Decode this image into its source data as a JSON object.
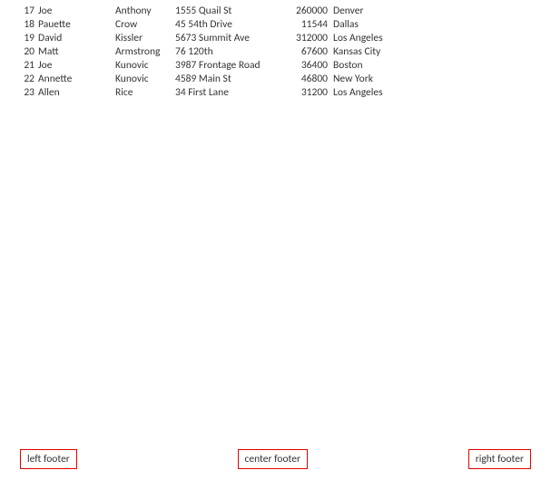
{
  "rows": [
    {
      "id": "17",
      "first": "Joe",
      "last": "Anthony",
      "addr": "1555 Quail St",
      "num": "260000",
      "city": "Denver"
    },
    {
      "id": "18",
      "first": "Pauette",
      "last": "Crow",
      "addr": "45 54th Drive",
      "num": "11544",
      "city": "Dallas"
    },
    {
      "id": "19",
      "first": "David",
      "last": "Kissler",
      "addr": "5673 Summit Ave",
      "num": "312000",
      "city": "Los Angeles"
    },
    {
      "id": "20",
      "first": "Matt",
      "last": "Armstrong",
      "addr": "76 120th",
      "num": "67600",
      "city": "Kansas City"
    },
    {
      "id": "21",
      "first": "Joe",
      "last": "Kunovic",
      "addr": "3987 Frontage Road",
      "num": "36400",
      "city": "Boston"
    },
    {
      "id": "22",
      "first": "Annette",
      "last": "Kunovic",
      "addr": "4589 Main St",
      "num": "46800",
      "city": "New York"
    },
    {
      "id": "23",
      "first": "Allen",
      "last": "Rice",
      "addr": "34 First Lane",
      "num": "31200",
      "city": "Los Angeles"
    }
  ],
  "footer": {
    "left": "left footer",
    "center": "center footer",
    "right": "right footer"
  }
}
